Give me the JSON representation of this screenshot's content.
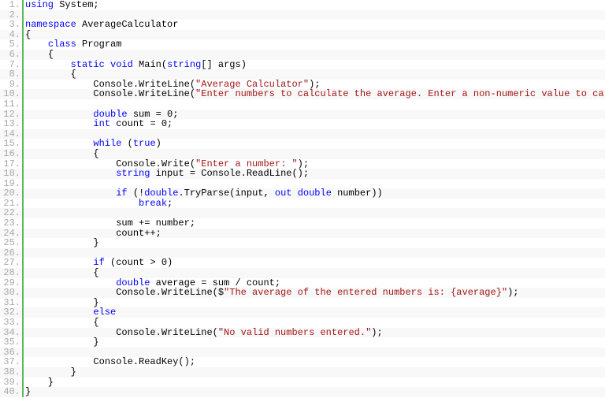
{
  "lines": [
    {
      "n": "1.",
      "segs": [
        {
          "c": "kw",
          "t": "using"
        },
        {
          "c": "",
          "t": " System;"
        }
      ]
    },
    {
      "n": "2.",
      "segs": []
    },
    {
      "n": "3.",
      "segs": [
        {
          "c": "kw",
          "t": "namespace"
        },
        {
          "c": "",
          "t": " AverageCalculator"
        }
      ]
    },
    {
      "n": "4.",
      "segs": [
        {
          "c": "",
          "t": "{"
        }
      ]
    },
    {
      "n": "5.",
      "segs": [
        {
          "c": "",
          "t": "    "
        },
        {
          "c": "kw",
          "t": "class"
        },
        {
          "c": "",
          "t": " Program"
        }
      ]
    },
    {
      "n": "6.",
      "segs": [
        {
          "c": "",
          "t": "    {"
        }
      ]
    },
    {
      "n": "7.",
      "segs": [
        {
          "c": "",
          "t": "        "
        },
        {
          "c": "kw",
          "t": "static"
        },
        {
          "c": "",
          "t": " "
        },
        {
          "c": "kw",
          "t": "void"
        },
        {
          "c": "",
          "t": " Main("
        },
        {
          "c": "kw",
          "t": "string"
        },
        {
          "c": "",
          "t": "[] args)"
        }
      ]
    },
    {
      "n": "8.",
      "segs": [
        {
          "c": "",
          "t": "        {"
        }
      ]
    },
    {
      "n": "9.",
      "segs": [
        {
          "c": "",
          "t": "            Console.WriteLine("
        },
        {
          "c": "str",
          "t": "\"Average Calculator\""
        },
        {
          "c": "",
          "t": ");"
        }
      ]
    },
    {
      "n": "10.",
      "segs": [
        {
          "c": "",
          "t": "            Console.WriteLine("
        },
        {
          "c": "str",
          "t": "\"Enter numbers to calculate the average. Enter a non-numeric value to calculate the result.\""
        },
        {
          "c": "",
          "t": ");"
        }
      ]
    },
    {
      "n": "11.",
      "segs": []
    },
    {
      "n": "12.",
      "segs": [
        {
          "c": "",
          "t": "            "
        },
        {
          "c": "kw",
          "t": "double"
        },
        {
          "c": "",
          "t": " sum = 0;"
        }
      ]
    },
    {
      "n": "13.",
      "segs": [
        {
          "c": "",
          "t": "            "
        },
        {
          "c": "kw",
          "t": "int"
        },
        {
          "c": "",
          "t": " count = 0;"
        }
      ]
    },
    {
      "n": "14.",
      "segs": []
    },
    {
      "n": "15.",
      "segs": [
        {
          "c": "",
          "t": "            "
        },
        {
          "c": "kw",
          "t": "while"
        },
        {
          "c": "",
          "t": " ("
        },
        {
          "c": "kw",
          "t": "true"
        },
        {
          "c": "",
          "t": ")"
        }
      ]
    },
    {
      "n": "16.",
      "segs": [
        {
          "c": "",
          "t": "            {"
        }
      ]
    },
    {
      "n": "17.",
      "segs": [
        {
          "c": "",
          "t": "                Console.Write("
        },
        {
          "c": "str",
          "t": "\"Enter a number: \""
        },
        {
          "c": "",
          "t": ");"
        }
      ]
    },
    {
      "n": "18.",
      "segs": [
        {
          "c": "",
          "t": "                "
        },
        {
          "c": "kw",
          "t": "string"
        },
        {
          "c": "",
          "t": " input = Console.ReadLine();"
        }
      ]
    },
    {
      "n": "19.",
      "segs": []
    },
    {
      "n": "20.",
      "segs": [
        {
          "c": "",
          "t": "                "
        },
        {
          "c": "kw",
          "t": "if"
        },
        {
          "c": "",
          "t": " (!"
        },
        {
          "c": "kw",
          "t": "double"
        },
        {
          "c": "",
          "t": ".TryParse(input, "
        },
        {
          "c": "kw",
          "t": "out"
        },
        {
          "c": "",
          "t": " "
        },
        {
          "c": "kw",
          "t": "double"
        },
        {
          "c": "",
          "t": " number))"
        }
      ]
    },
    {
      "n": "21.",
      "segs": [
        {
          "c": "",
          "t": "                    "
        },
        {
          "c": "kw",
          "t": "break"
        },
        {
          "c": "",
          "t": ";"
        }
      ]
    },
    {
      "n": "22.",
      "segs": []
    },
    {
      "n": "23.",
      "segs": [
        {
          "c": "",
          "t": "                sum += number;"
        }
      ]
    },
    {
      "n": "24.",
      "segs": [
        {
          "c": "",
          "t": "                count++;"
        }
      ]
    },
    {
      "n": "25.",
      "segs": [
        {
          "c": "",
          "t": "            }"
        }
      ]
    },
    {
      "n": "26.",
      "segs": []
    },
    {
      "n": "27.",
      "segs": [
        {
          "c": "",
          "t": "            "
        },
        {
          "c": "kw",
          "t": "if"
        },
        {
          "c": "",
          "t": " (count > 0)"
        }
      ]
    },
    {
      "n": "28.",
      "segs": [
        {
          "c": "",
          "t": "            {"
        }
      ]
    },
    {
      "n": "29.",
      "segs": [
        {
          "c": "",
          "t": "                "
        },
        {
          "c": "kw",
          "t": "double"
        },
        {
          "c": "",
          "t": " average = sum / count;"
        }
      ]
    },
    {
      "n": "30.",
      "segs": [
        {
          "c": "",
          "t": "                Console.WriteLine($"
        },
        {
          "c": "str",
          "t": "\"The average of the entered numbers is: {average}\""
        },
        {
          "c": "",
          "t": ");"
        }
      ]
    },
    {
      "n": "31.",
      "segs": [
        {
          "c": "",
          "t": "            }"
        }
      ]
    },
    {
      "n": "32.",
      "segs": [
        {
          "c": "",
          "t": "            "
        },
        {
          "c": "kw",
          "t": "else"
        }
      ]
    },
    {
      "n": "33.",
      "segs": [
        {
          "c": "",
          "t": "            {"
        }
      ]
    },
    {
      "n": "34.",
      "segs": [
        {
          "c": "",
          "t": "                Console.WriteLine("
        },
        {
          "c": "str",
          "t": "\"No valid numbers entered.\""
        },
        {
          "c": "",
          "t": ");"
        }
      ]
    },
    {
      "n": "35.",
      "segs": [
        {
          "c": "",
          "t": "            }"
        }
      ]
    },
    {
      "n": "36.",
      "segs": []
    },
    {
      "n": "37.",
      "segs": [
        {
          "c": "",
          "t": "            Console.ReadKey();"
        }
      ]
    },
    {
      "n": "38.",
      "segs": [
        {
          "c": "",
          "t": "        }"
        }
      ]
    },
    {
      "n": "39.",
      "segs": [
        {
          "c": "",
          "t": "    }"
        }
      ]
    },
    {
      "n": "40.",
      "segs": [
        {
          "c": "",
          "t": "}"
        }
      ]
    }
  ]
}
